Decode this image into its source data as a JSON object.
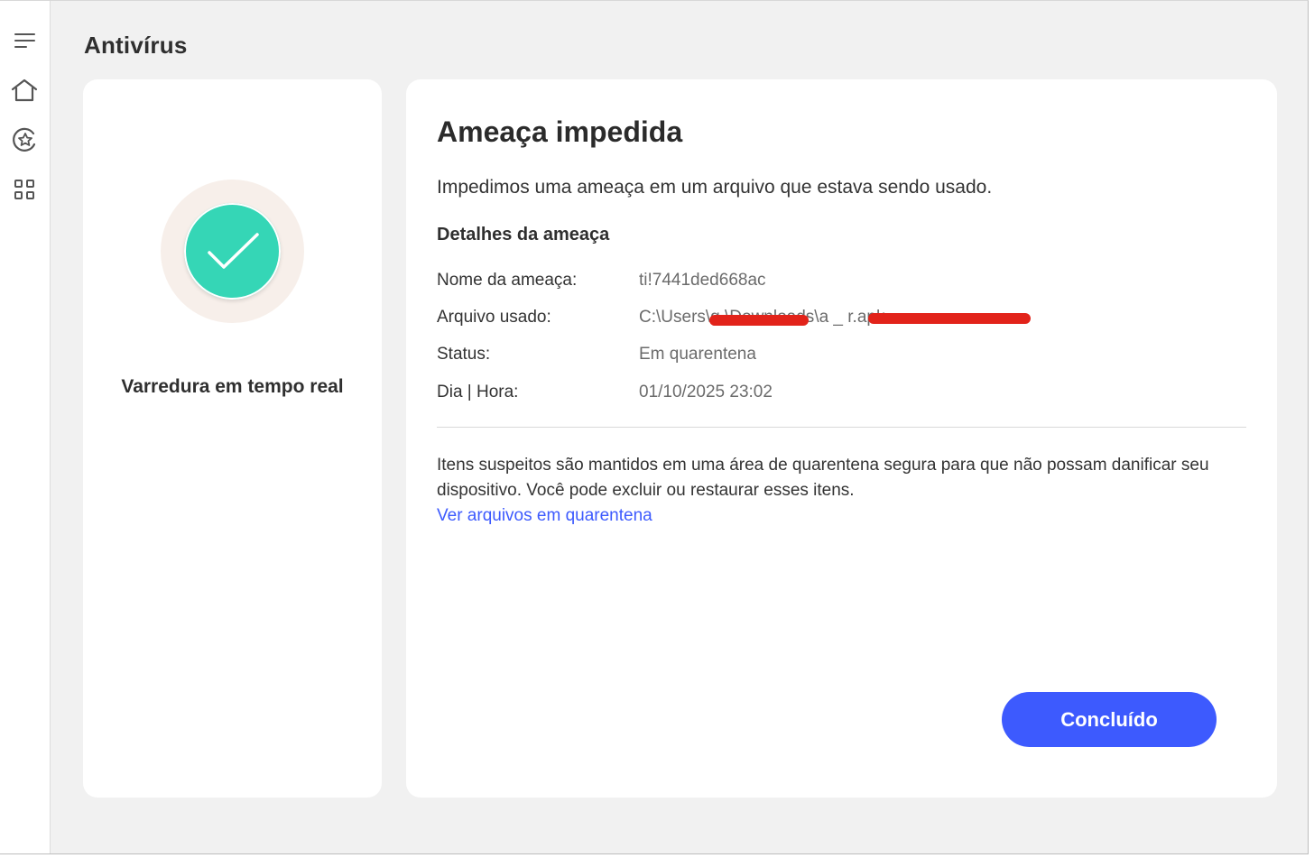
{
  "app": {
    "page_title": "Antivírus"
  },
  "sidebar": {
    "items": [
      {
        "icon": "menu-icon"
      },
      {
        "icon": "home-icon"
      },
      {
        "icon": "protection-icon"
      },
      {
        "icon": "apps-grid-icon"
      }
    ]
  },
  "left_panel": {
    "status_icon": "checkmark-icon",
    "label": "Varredura em tempo real"
  },
  "threat": {
    "title": "Ameaça impedida",
    "description": "Impedimos uma ameaça em um arquivo que estava sendo usado.",
    "details_heading": "Detalhes da ameaça",
    "details": [
      {
        "label": "Nome da ameaça:",
        "value": "ti!7441ded668ac"
      },
      {
        "label": "Arquivo usado:",
        "value": "C:\\Users\\g   \\Downloads\\a     _     r.apk"
      },
      {
        "label": "Status:",
        "value": "Em quarentena"
      },
      {
        "label": "Dia | Hora:",
        "value": "01/10/2025 23:02"
      }
    ],
    "info": "Itens suspeitos são mantidos em uma área de quarentena segura para que não possam danificar seu dispositivo. Você pode excluir ou restaurar esses itens.",
    "link": "Ver arquivos em quarentena",
    "done_label": "Concluído"
  },
  "colors": {
    "accent": "#3d5afe",
    "success": "#35d6b6",
    "redaction": "#e2231a"
  }
}
